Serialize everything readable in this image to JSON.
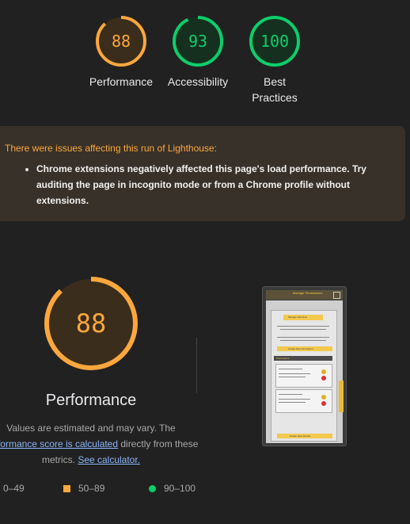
{
  "scores": [
    {
      "value": "88",
      "label": "Performance",
      "color": "#fca73d",
      "fraction": 0.88
    },
    {
      "value": "93",
      "label": "Accessibility",
      "color": "#0cce6b",
      "fraction": 0.93
    },
    {
      "value": "100",
      "label": "Best Practices",
      "color": "#0cce6b",
      "fraction": 1.0
    }
  ],
  "warning": {
    "title": "There were issues affecting this run of Lighthouse:",
    "item": "Chrome extensions negatively affected this page's load performance. Try auditing the page in incognito mode or from a Chrome profile without extensions."
  },
  "main": {
    "score": "88",
    "fraction": 0.88,
    "title": "Performance",
    "note_part1": "Values are estimated and may vary. The ",
    "note_link1": "performance score is calculated",
    "note_part2": " directly from these metrics. ",
    "note_link2": "See calculator."
  },
  "legend": [
    {
      "range": "0–49",
      "icon": "red-triangle-icon"
    },
    {
      "range": "50–89",
      "icon": "orange-square-icon",
      "color": "#fca73d"
    },
    {
      "range": "90–100",
      "icon": "green-circle-icon",
      "color": "#0cce6b"
    }
  ],
  "thumbnail": {
    "header": "Manage Permissions",
    "heading": "Manage Sub-Nets",
    "button1": "Create New Permission",
    "section": "Permissions",
    "button2": "Create New Subnet"
  }
}
